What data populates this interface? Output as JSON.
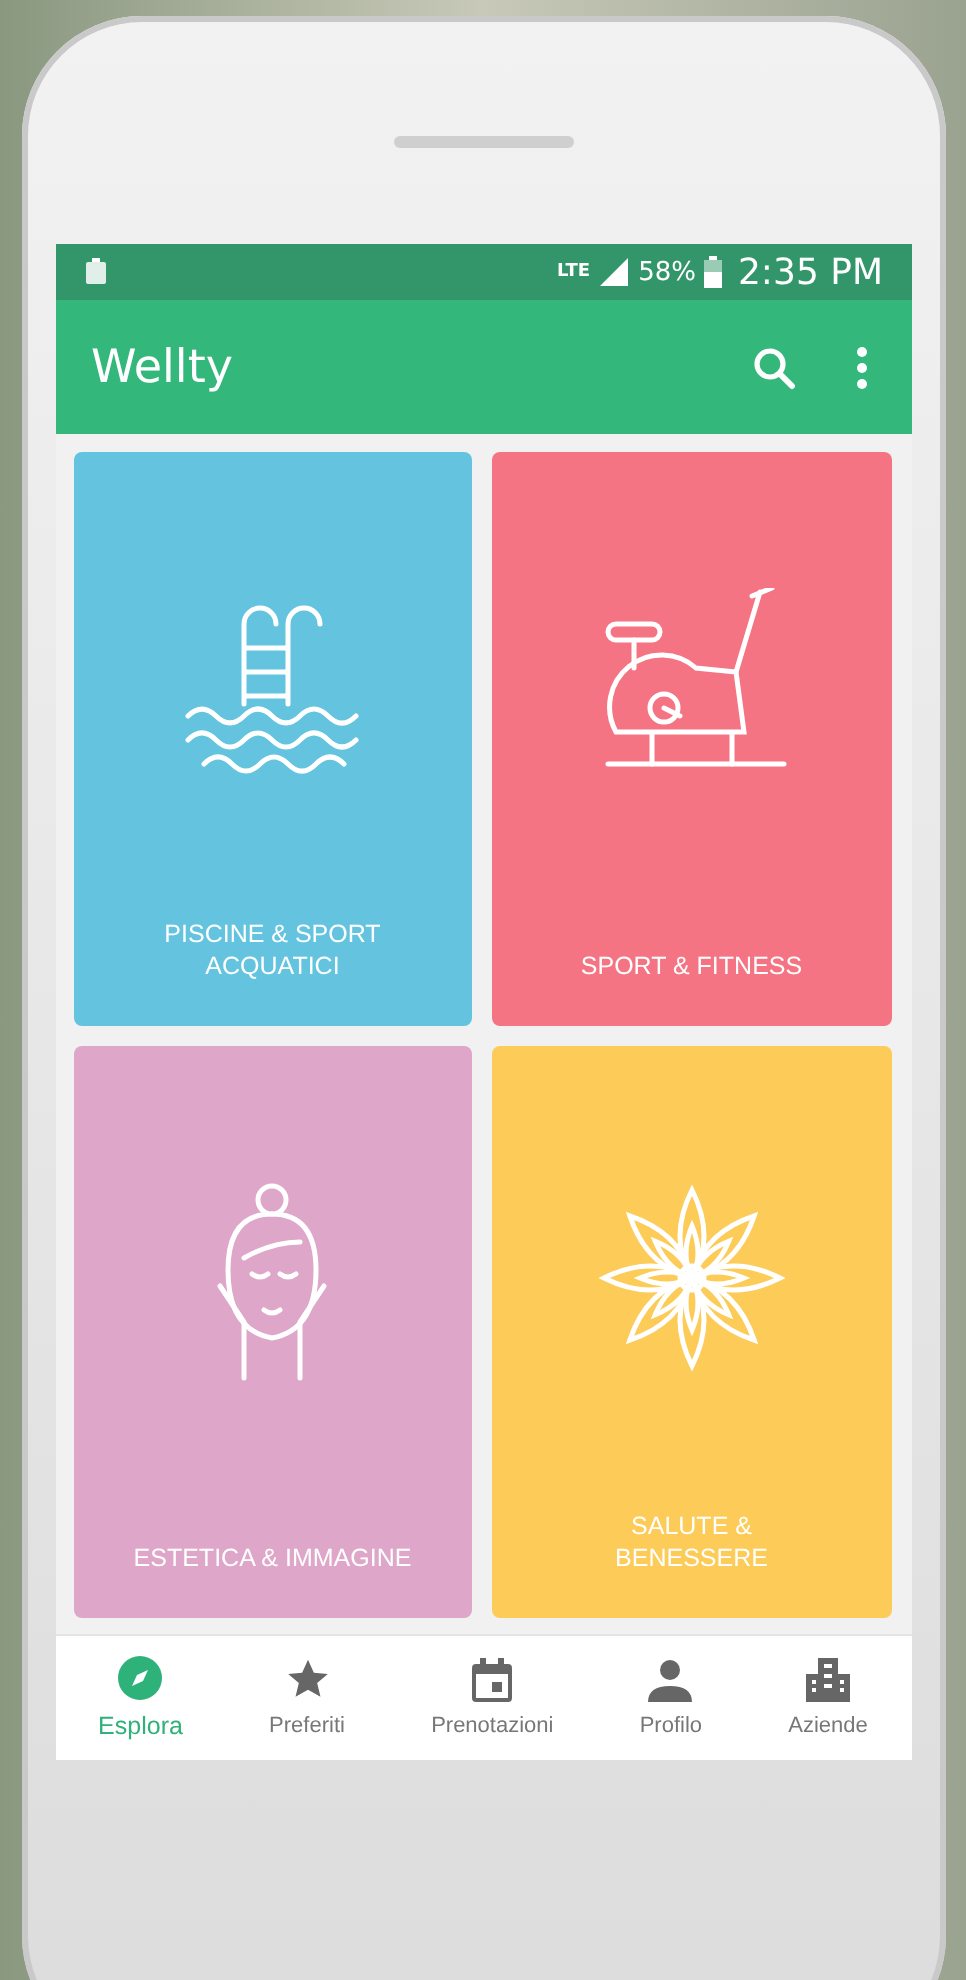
{
  "status_bar": {
    "network": "LTE",
    "battery": "58%",
    "time": "2:35 PM"
  },
  "app_bar": {
    "title": "Wellty"
  },
  "categories": [
    {
      "label": "PISCINE & SPORT ACQUATICI",
      "color": "#64c4df",
      "kind": "pool"
    },
    {
      "label": "SPORT & FITNESS",
      "color": "#f47483",
      "kind": "bike"
    },
    {
      "label": "ESTETICA & IMMAGINE",
      "color": "#dea6c9",
      "kind": "face"
    },
    {
      "label": "SALUTE & BENESSERE",
      "color": "#fccb58",
      "kind": "flower"
    }
  ],
  "bottom_nav": [
    {
      "label": "Esplora",
      "kind": "compass",
      "selected": true
    },
    {
      "label": "Preferiti",
      "kind": "star",
      "selected": false
    },
    {
      "label": "Prenotazioni",
      "kind": "calendar",
      "selected": false
    },
    {
      "label": "Profilo",
      "kind": "person",
      "selected": false
    },
    {
      "label": "Aziende",
      "kind": "building",
      "selected": false
    }
  ]
}
